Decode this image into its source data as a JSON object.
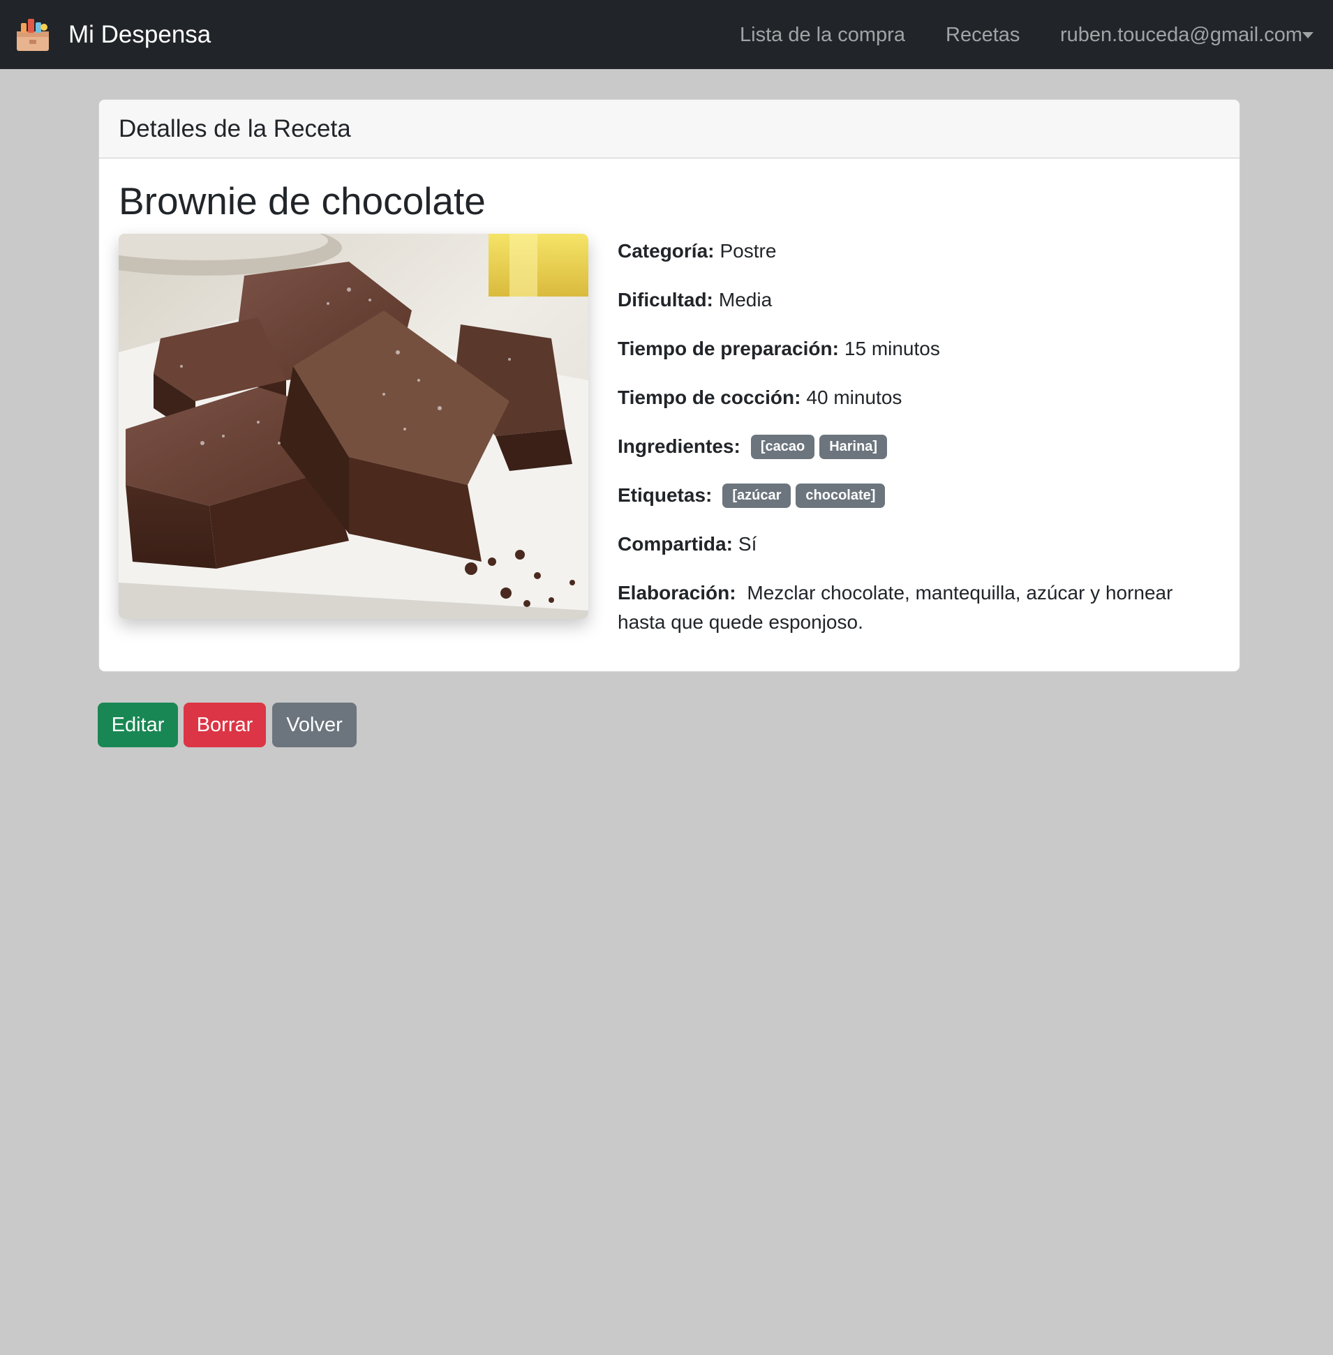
{
  "navbar": {
    "brand": "Mi Despensa",
    "brand_logo_icon": "pantry-box-icon",
    "links": {
      "lista": "Lista de la compra",
      "recetas": "Recetas",
      "user": "ruben.touceda@gmail.com"
    },
    "user_menu_icon": "caret-down-icon"
  },
  "card": {
    "header": "Detalles de la Receta",
    "recipe_title": "Brownie de chocolate",
    "image_subject": "brownie-photo",
    "details": {
      "categoria_label": "Categoría:",
      "categoria_value": "Postre",
      "dificultad_label": "Dificultad:",
      "dificultad_value": "Media",
      "preparacion_label": "Tiempo de preparación:",
      "preparacion_value": "15 minutos",
      "coccion_label": "Tiempo de cocción:",
      "coccion_value": "40 minutos",
      "ingredientes_label": "Ingredientes:",
      "ingredientes": [
        "[cacao",
        "Harina]"
      ],
      "etiquetas_label": "Etiquetas:",
      "etiquetas": [
        "[azúcar",
        "chocolate]"
      ],
      "compartida_label": "Compartida:",
      "compartida_value": "Sí",
      "elaboracion_label": "Elaboración:",
      "elaboracion_value": "Mezclar chocolate, mantequilla, azúcar y hornear hasta que quede esponjoso."
    }
  },
  "actions": {
    "edit": "Editar",
    "delete": "Borrar",
    "back": "Volver"
  },
  "colors": {
    "navbar_bg": "#212529",
    "page_bg": "#c9c9c9",
    "edit": "#198754",
    "delete": "#dc3545",
    "back": "#6c757d",
    "badge": "#6c757d"
  }
}
